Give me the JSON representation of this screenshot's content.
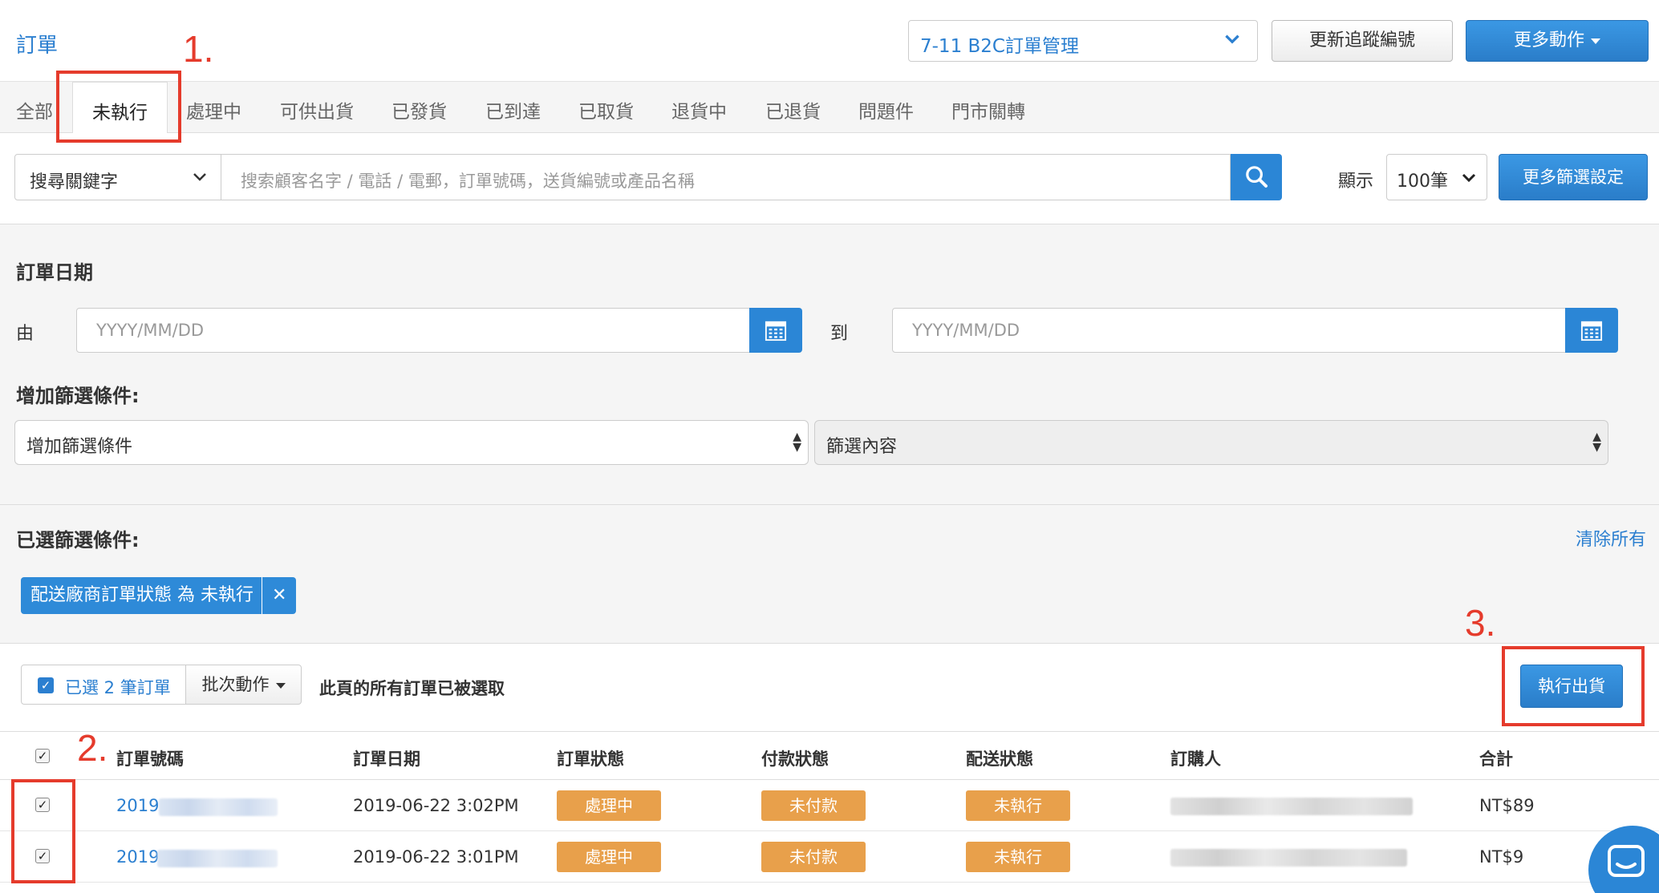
{
  "header": {
    "title": "訂單",
    "store_select": "7-11 B2C訂單管理",
    "update_tracking_button": "更新追蹤編號",
    "more_actions_button": "更多動作"
  },
  "tabs": [
    {
      "label": "全部"
    },
    {
      "label": "未執行",
      "active": true
    },
    {
      "label": "處理中"
    },
    {
      "label": "可供出貨"
    },
    {
      "label": "已發貨"
    },
    {
      "label": "已到達"
    },
    {
      "label": "已取貨"
    },
    {
      "label": "退貨中"
    },
    {
      "label": "已退貨"
    },
    {
      "label": "問題件"
    },
    {
      "label": "門市關轉"
    }
  ],
  "search": {
    "keyword_select": "搜尋關鍵字",
    "placeholder": "搜索顧客名字 / 電話 / 電郵，訂單號碼，送貨編號或產品名稱",
    "display_label": "顯示",
    "count_select": "100筆",
    "more_filters_button": "更多篩選設定"
  },
  "filters": {
    "order_date_label": "訂單日期",
    "from_label": "由",
    "to_label": "到",
    "date_placeholder": "YYYY/MM/DD",
    "add_condition_label": "增加篩選條件:",
    "add_condition_select": "增加篩選條件",
    "filter_content_select": "篩選內容"
  },
  "selected_filters": {
    "label": "已選篩選條件:",
    "clear_all": "清除所有",
    "chip": "配送廠商訂單狀態 為 未執行"
  },
  "bulk": {
    "selected_count": "已選 2 筆訂單",
    "batch_button": "批次動作",
    "all_selected_text": "此頁的所有訂單已被選取",
    "ship_button": "執行出貨"
  },
  "table": {
    "headers": [
      "訂單號碼",
      "訂單日期",
      "訂單狀態",
      "付款狀態",
      "配送狀態",
      "訂購人",
      "合計"
    ],
    "rows": [
      {
        "order_no": "2019",
        "date": "2019-06-22 3:02PM",
        "order_status": "處理中",
        "payment_status": "未付款",
        "delivery_status": "未執行",
        "total": "NT$89"
      },
      {
        "order_no": "2019",
        "date": "2019-06-22 3:01PM",
        "order_status": "處理中",
        "payment_status": "未付款",
        "delivery_status": "未執行",
        "total": "NT$9"
      }
    ]
  },
  "annotations": {
    "step1": "1.",
    "step2": "2.",
    "step3": "3."
  },
  "colors": {
    "accent": "#2b86d6",
    "status_badge": "#e8a04b",
    "annotation": "#e53b2c"
  }
}
